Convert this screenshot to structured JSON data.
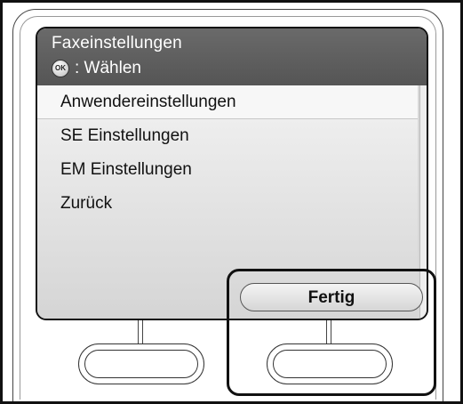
{
  "screen": {
    "title": "Faxeinstellungen",
    "hint_icon": "ok-icon",
    "hint_text": ": Wählen",
    "menu": [
      {
        "label": "Anwendereinstellungen",
        "selected": true
      },
      {
        "label": "SE Einstellungen",
        "selected": false
      },
      {
        "label": "EM Einstellungen",
        "selected": false
      },
      {
        "label": "Zurück",
        "selected": false
      }
    ],
    "done_button": "Fertig"
  }
}
